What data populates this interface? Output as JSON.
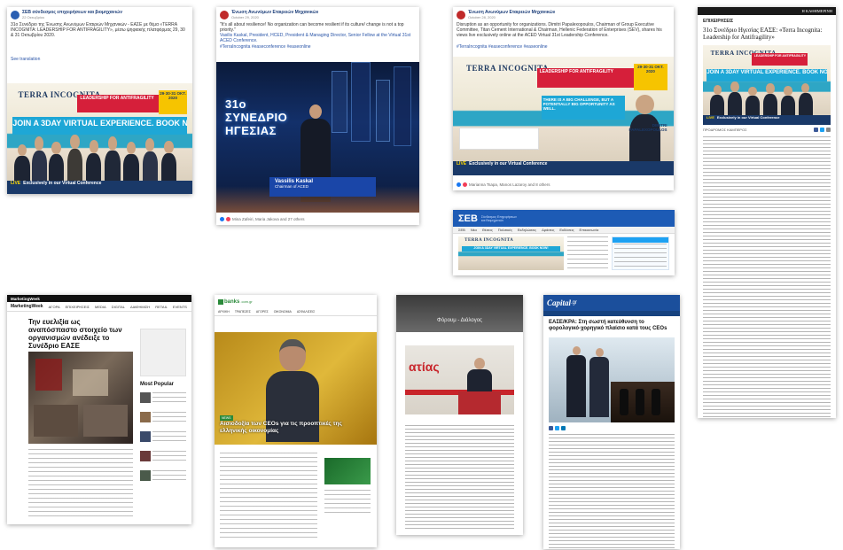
{
  "card1": {
    "page_name": "ΣΕΒ σύνδεσμος επιχειρήσεων και βιομηχανιών",
    "date": "22 Οκτωβρίου",
    "post_text": "31ο Συνέδριο της Ένωσης Ανωνύμων Εταιριών Μηχανικών - ΕΑΣΕ με θέμα «TERRA INCOGNITA: LEADERSHIP FOR ANTIFRAGILITY», μέσω ψηφιακής πλατφόρμας 29, 30 & 31 Οκτωβρίου 2020.",
    "see_translation": "See translation"
  },
  "card2": {
    "page_name": "Ένωση Ανωνύμων Εταιρειών Μηχανικών",
    "date": "October 29, 2020",
    "post_text": "\"It's all about resilience! No organization can become resilient if its culture/ change is not a top priority.\"",
    "people_line": "Vasilis Kaskal, President, HCED, President & Managing Director, Senior Fellow at the Virtual 31st ACED Conference.",
    "tags": "#TerraIncognita #easeconference #easeonline",
    "video_title": "31ο ΣΥΝΕΔΡΙΟ ΗΓΕΣΙΑΣ",
    "lower_name": "Vassilis Kaskal",
    "lower_role": "Chairman of ACED",
    "reactions": "Mina Zafeiri, Maria Jakova and 27 others"
  },
  "card3": {
    "page_name": "Ένωση Ανωνύμων Εταιρειών Μηχανικών",
    "date": "October 28, 2020",
    "post_text": "Disruption as an opportunity for organizations. Dimitri Papalexopoulos, Chairman of Group Executive Committee, Titan Cement International & Chairman, Hellenic Federation of Enterprises (SEV), shares his views live exclusively online at the ACED Virtual 31st Leadership Conference.",
    "tags": "#TerraIncognita #easeconference #easeonline",
    "quote": "THERE IS A BIG CHALLENGE, BUT A POTENTIALLY BIG OPPORTUNITY AS WELL.",
    "speaker": "DIMITRI PAPALEXOPOULOS",
    "reactions": "Marianna Tsapa, Manos Lazaroy and 8 others"
  },
  "card4": {
    "section": "ΕΠΙΧΕΙΡΗΣΕΙΣ",
    "headline": "31ο Συνέδριο Ηγεσίας ΕΑΣΕ: «Terra Incognita: Leadership for Antifragility»",
    "author": "ΠΡΟΔΡΟΜΟΣ ΚΑΜΠΕΡΟΣ",
    "masthead": "Η ΚΑΘΗΜΕΡΙΝΗ"
  },
  "card5": {
    "logo": "ΣΕΒ",
    "tagline": "Σύνδεσμος Επιχειρήσεων και Βιομηχανιών",
    "nav": [
      "ΣΕΒ",
      "Νέα",
      "Θέσεις",
      "Πολιτικές",
      "Εκδηλώσεις",
      "Δράσεις",
      "Εκδόσεις",
      "Επικοινωνία"
    ]
  },
  "card6": {
    "logo": "MarketingWeek",
    "headline": "Την ευελιξία ως αναπόσπαστο στοιχείο των οργανισμών ανέδειξε το Συνέδριο ΕΑΣΕ",
    "most_popular": "Most Popular",
    "nav": [
      "ΑΓΟΡΑ",
      "ΕΠΙΧΕΙΡΗΣΕΙΣ",
      "MEDIA",
      "DIGITAL",
      "ΔΙΑΦΗΜΙΣΗ",
      "RETAIL",
      "EVENTS"
    ]
  },
  "card7": {
    "logo": "banks",
    "logo_suffix": ".com.gr",
    "headline": "Αισιοδοξία των CEOs για τις προοπτικές της ελληνικής οικονομίας",
    "category": "NEWS",
    "nav": [
      "ΑΡΧΙΚΗ",
      "ΤΡΑΠΕΖΕΣ",
      "ΑΓΟΡΕΣ",
      "ΟΙΚΟΝΟΜΙΑ",
      "ΑΣΦΑΛΙΣΕΙΣ"
    ]
  },
  "card8": {
    "section": "Φόρουμ - Διάλογος",
    "stage_text": "ατίας"
  },
  "card9": {
    "logo": "Capital",
    "logo_suffix": ".gr",
    "headline": "ΕΑΣΕ/ΚΡΑ: Στη σωστή κατεύθυνση το φορολογικό-χορηγικό πλαίσιο κατά τους CEOs"
  },
  "banner": {
    "brand": "TERRA INCOGNITA",
    "lead": "LEADERSHIP FOR ANTIFRAGILITY",
    "date": "29·30·31 ΟΚΤ. 2020",
    "join": "JOIN A 3DAY VIRTUAL EXPERIENCE. BOOK NOW!",
    "live": "LIVE",
    "live_text": "Exclusively in our Virtual Conference"
  },
  "colors": {
    "accent_blue": "#1ea7d6",
    "brand_red": "#d61f3a",
    "navy": "#1a3968",
    "yellow": "#f6c400"
  }
}
